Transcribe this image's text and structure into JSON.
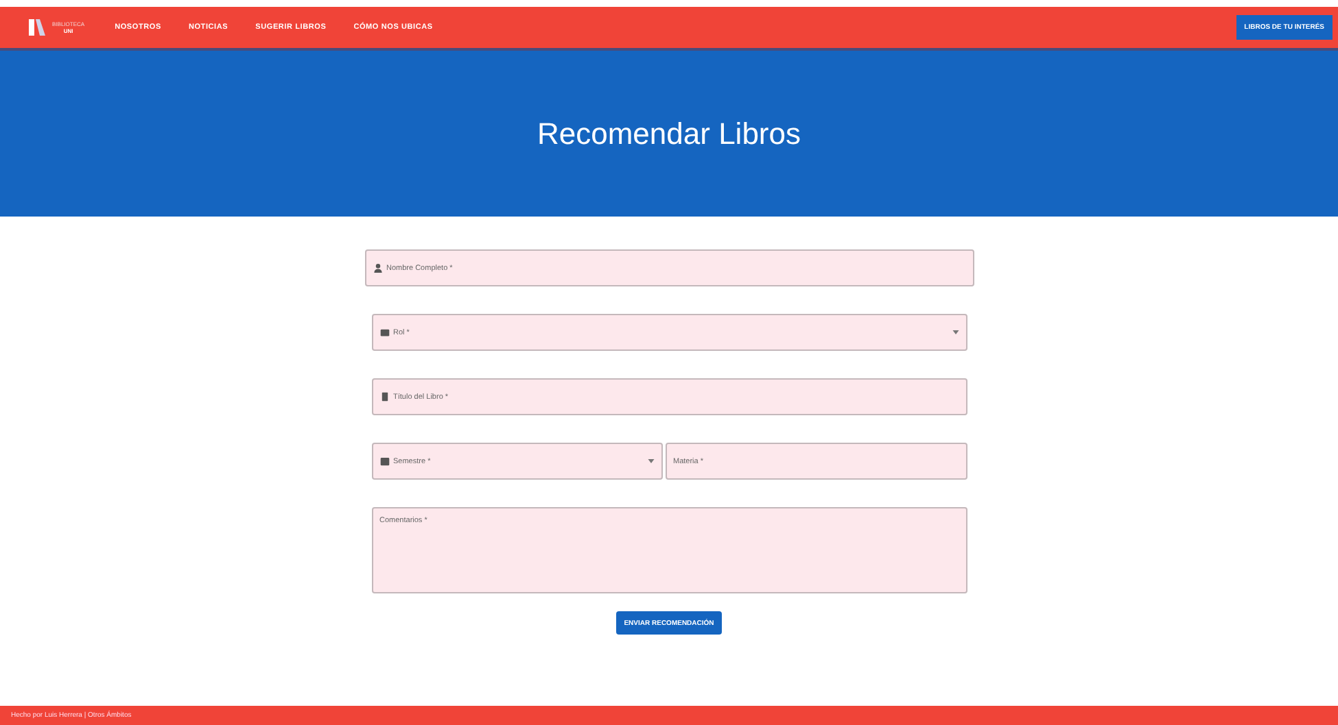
{
  "navbar": {
    "logo": {
      "line_1": "BIBLIOTECA",
      "line_2": "UNI"
    },
    "links": [
      "NOSOTROS",
      "NOTICIAS",
      "SUGERIR LIBROS",
      "CÓMO NOS UBICAS"
    ],
    "action": "LIBROS DE TU INTERÉS"
  },
  "hero": {
    "title": "Recomendar Libros"
  },
  "form": {
    "fields": [
      {
        "kind": "text",
        "placeholder": "Nombre Completo *"
      },
      {
        "kind": "select",
        "placeholder": "Rol *"
      },
      {
        "kind": "text",
        "placeholder": "Título del Libro *"
      },
      {
        "kind": "pair",
        "items": [
          {
            "kind": "select",
            "placeholder": "Semestre *"
          },
          {
            "kind": "text",
            "placeholder": "Materia *"
          }
        ]
      },
      {
        "kind": "textarea",
        "placeholder": "Comentarios *"
      }
    ],
    "submit": "ENVIAR RECOMENDACIÓN"
  },
  "footer": {
    "text": "Hecho por Luis Herrera | Otros Ámbitos"
  }
}
